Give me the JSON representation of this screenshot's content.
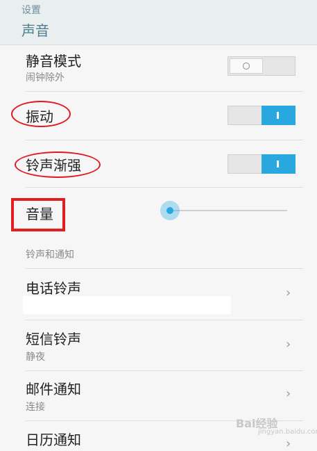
{
  "header": {
    "breadcrumb": "设置",
    "title": "声音"
  },
  "settings": {
    "silent_mode": {
      "label": "静音模式",
      "sublabel": "闹钟除外",
      "enabled": false
    },
    "vibrate": {
      "label": "振动",
      "enabled": true
    },
    "ring_crescendo": {
      "label": "铃声渐强",
      "enabled": true
    },
    "volume": {
      "label": "音量",
      "level": 0.0
    }
  },
  "section": {
    "title": "铃声和通知"
  },
  "items": [
    {
      "label": "电话铃声",
      "sublabel": ""
    },
    {
      "label": "短信铃声",
      "sublabel": "静夜"
    },
    {
      "label": "邮件通知",
      "sublabel": "连接"
    },
    {
      "label": "日历通知",
      "sublabel": ""
    }
  ],
  "watermark": {
    "brand": "Bai经验",
    "url": "jingyan.baidu.com"
  },
  "colors": {
    "accent": "#28a8df",
    "annotation": "#e0181f"
  }
}
